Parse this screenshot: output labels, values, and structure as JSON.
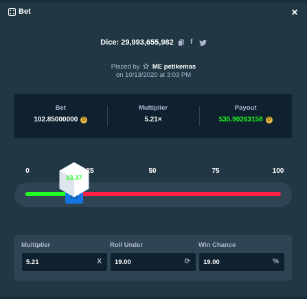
{
  "header": {
    "title": "Bet",
    "close_symbol": "×"
  },
  "dice": {
    "text": "Dice: 29,993,655,982"
  },
  "placed": {
    "prefix": "Placed by",
    "user": "ME petikemas",
    "date_line": "on 10/13/2020 at 3:03 PM"
  },
  "stats": [
    {
      "label": "Bet",
      "value": "102.85000000",
      "coin": true,
      "color": "#ffffff"
    },
    {
      "label": "Multiplier",
      "value": "5.21×",
      "coin": false,
      "color": "#ffffff"
    },
    {
      "label": "Payout",
      "value": "535.90263158",
      "coin": true,
      "color": "#1fff20"
    }
  ],
  "slider": {
    "ticks": [
      "0",
      "25",
      "50",
      "75",
      "100"
    ],
    "tick_values": [
      0,
      25,
      50,
      75,
      100
    ],
    "roll_under": 19.0,
    "result": "13.37",
    "result_value": 13.37,
    "colors": {
      "win": "#1fff20",
      "lose": "#fe2247",
      "handle": "#1475e1"
    }
  },
  "fields": {
    "multiplier": {
      "label": "Multiplier",
      "value": "5.21",
      "suffix": "X"
    },
    "roll_under": {
      "label": "Roll Under",
      "value": "19.00",
      "suffix": "⟳"
    },
    "win_chance": {
      "label": "Win Chance",
      "value": "19.00",
      "suffix": "%"
    }
  },
  "icons": {
    "title": "dice-icon",
    "copy": "copy-icon",
    "facebook": "facebook-icon",
    "twitter": "twitter-icon",
    "star": "star-icon",
    "refresh": "refresh-icon",
    "coin": "coin-icon"
  }
}
